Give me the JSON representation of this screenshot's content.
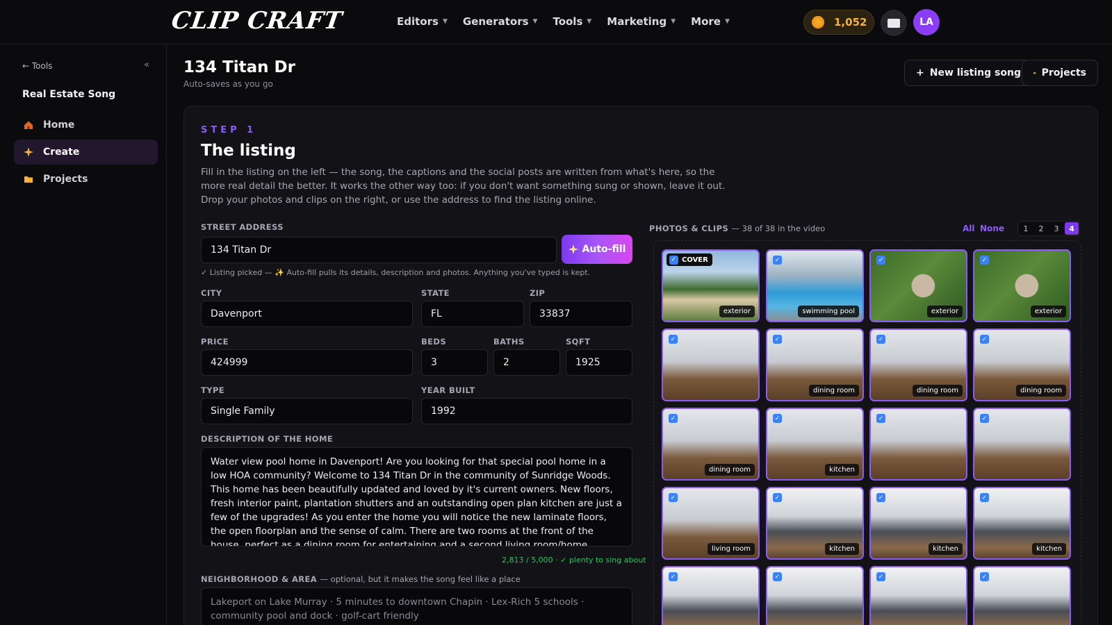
{
  "header": {
    "logo": "CLIP CRAFT",
    "nav": [
      {
        "label": "Editors"
      },
      {
        "label": "Generators"
      },
      {
        "label": "Tools"
      },
      {
        "label": "Marketing"
      },
      {
        "label": "More"
      }
    ],
    "credits": "1,052",
    "avatar_initials": "LA"
  },
  "sidebar": {
    "back_label": "← Tools",
    "collapse_label": "«",
    "title": "Real Estate Song",
    "items": [
      {
        "label": "Home",
        "icon": "home-icon",
        "active": false
      },
      {
        "label": "Create",
        "icon": "sparkle-icon",
        "active": true
      },
      {
        "label": "Projects",
        "icon": "folder-icon",
        "active": false
      }
    ]
  },
  "page": {
    "title": "134 Titan Dr",
    "subtitle": "Auto-saves as you go",
    "new_song_label": "New listing song",
    "projects_label": "Projects"
  },
  "step": {
    "kicker": "STEP 1",
    "title": "The listing",
    "intro": "Fill in the listing on the left — the song, the captions and the social posts are written from what's here, so the more real detail the better. It works the other way too: if you don't want something sung or shown, leave it out. Drop your photos and clips on the right, or use the address to find the listing online."
  },
  "form": {
    "street_label": "STREET ADDRESS",
    "street": "134 Titan Dr",
    "autofill_label": "Auto-fill",
    "hint": "✓ Listing picked — ✨ Auto-fill pulls its details, description and photos. Anything you've typed is kept.",
    "city_label": "CITY",
    "city": "Davenport",
    "state_label": "STATE",
    "state": "FL",
    "zip_label": "ZIP",
    "zip": "33837",
    "price_label": "PRICE",
    "price": "424999",
    "beds_label": "BEDS",
    "beds": "3",
    "baths_label": "BATHS",
    "baths": "2",
    "sqft_label": "SQFT",
    "sqft": "1925",
    "type_label": "TYPE",
    "type": "Single Family",
    "year_label": "YEAR BUILT",
    "year": "1992",
    "desc_label": "DESCRIPTION OF THE HOME",
    "description": "Water view pool home in Davenport! Are you looking for that special pool home in a low HOA community? Welcome to 134 Titan Dr in the community of Sunridge Woods. This home has been beautifully updated and loved by it's current owners. New floors, fresh interior paint, plantation shutters and an outstanding open plan kitchen are just a few of the upgrades! As you enter the home you will notice the new laminate floors, the open floorplan and the sense of calm. There are two rooms at the front of the house, perfect as a dining room for entertaining and a second living room/home office/flex space. As you enter the spacious",
    "counter": "2,813 / 5,000 · ✓ plenty to sing about",
    "area_label": "NEIGHBORHOOD & AREA",
    "area_optional": "— optional, but it makes the song feel like a place",
    "area_placeholder": "Lakeport on Lake Murray · 5 minutes to downtown Chapin · Lex-Rich 5 schools · community pool and dock · golf-cart friendly"
  },
  "media": {
    "label": "PHOTOS & CLIPS",
    "count": "— 38 of 38 in the video",
    "all_label": "All",
    "none_label": "None",
    "pages": [
      "1",
      "2",
      "3",
      "4"
    ],
    "active_page": "4",
    "cover_label": "COVER",
    "tiles": [
      {
        "tag": "exterior",
        "kind": "exterior",
        "cover": true
      },
      {
        "tag": "swimming pool",
        "kind": "pool"
      },
      {
        "tag": "exterior",
        "kind": "aerial"
      },
      {
        "tag": "exterior",
        "kind": "aerial"
      },
      {
        "tag": "",
        "kind": "interior"
      },
      {
        "tag": "dining room",
        "kind": "interior"
      },
      {
        "tag": "dining room",
        "kind": "interior"
      },
      {
        "tag": "dining room",
        "kind": "interior"
      },
      {
        "tag": "dining room",
        "kind": "interior"
      },
      {
        "tag": "kitchen",
        "kind": "interior"
      },
      {
        "tag": "",
        "kind": "interior"
      },
      {
        "tag": "",
        "kind": "interior"
      },
      {
        "tag": "living room",
        "kind": "interior"
      },
      {
        "tag": "kitchen",
        "kind": "kitchen"
      },
      {
        "tag": "kitchen",
        "kind": "kitchen"
      },
      {
        "tag": "kitchen",
        "kind": "kitchen"
      },
      {
        "tag": "",
        "kind": "kitchen"
      },
      {
        "tag": "",
        "kind": "kitchen"
      },
      {
        "tag": "",
        "kind": "kitchen"
      },
      {
        "tag": "",
        "kind": "kitchen"
      }
    ]
  },
  "colors": {
    "accent": "#8b5cf6",
    "background": "#0b0b0e",
    "credits": "#f5b33a",
    "success": "#22c55e"
  }
}
